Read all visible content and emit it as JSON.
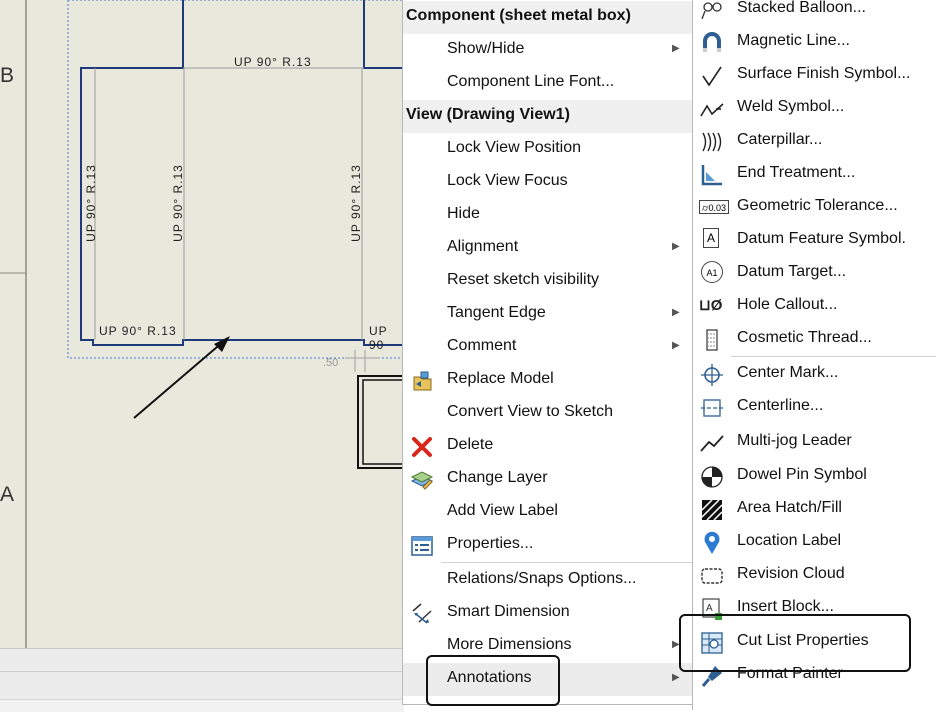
{
  "drawing": {
    "zone_b": "B",
    "zone_a": "A",
    "bend_note_top": "UP 90° R.13",
    "bend_note_v1": "UP 90° R.13",
    "bend_note_v2": "UP 90° R.13",
    "bend_note_v3": "UP 90° R.13",
    "bend_note_bottom_left": "UP 90° R.13",
    "bend_note_bottom_right": "UP 90",
    "dimension_value": ".50"
  },
  "context_menu": {
    "component_header": "Component (sheet metal box)",
    "show_hide": "Show/Hide",
    "component_line_font": "Component Line Font...",
    "view_header": "View (Drawing View1)",
    "lock_view_position": "Lock View Position",
    "lock_view_focus": "Lock View Focus",
    "hide": "Hide",
    "alignment": "Alignment",
    "reset_sketch_visibility": "Reset sketch visibility",
    "tangent_edge": "Tangent Edge",
    "comment": "Comment",
    "replace_model": "Replace Model",
    "convert_view_to_sketch": "Convert View to Sketch",
    "delete": "Delete",
    "change_layer": "Change Layer",
    "add_view_label": "Add View Label",
    "properties": "Properties...",
    "relations_snaps_options": "Relations/Snaps Options...",
    "smart_dimension": "Smart Dimension",
    "more_dimensions": "More Dimensions",
    "annotations": "Annotations"
  },
  "annotations_submenu": {
    "stacked_balloon": "Stacked Balloon...",
    "magnetic_line": "Magnetic Line...",
    "surface_finish_symbol": "Surface Finish Symbol...",
    "weld_symbol": "Weld Symbol...",
    "caterpillar": "Caterpillar...",
    "end_treatment": "End Treatment...",
    "geometric_tolerance": "Geometric Tolerance...",
    "datum_feature_symbol": "Datum Feature Symbol.",
    "datum_target": "Datum Target...",
    "hole_callout": "Hole Callout...",
    "cosmetic_thread": "Cosmetic Thread...",
    "center_mark": "Center Mark...",
    "centerline": "Centerline...",
    "multi_jog_leader": "Multi-jog Leader",
    "dowel_pin_symbol": "Dowel Pin Symbol",
    "area_hatch_fill": "Area Hatch/Fill",
    "location_label": "Location Label",
    "revision_cloud": "Revision Cloud",
    "insert_block": "Insert Block...",
    "cut_list_properties": "Cut List Properties",
    "format_painter": "Format Painter",
    "gtol_icon_text": "⌭0.03",
    "datum_icon_text": "A",
    "datum_target_icon_text": "A1",
    "hole_callout_icon_text": "⊔Ø"
  },
  "colors": {
    "drawing_background": "#e9e8dd",
    "sheet_line": "#1f3a7a",
    "menu_background": "#ffffff",
    "header_background": "#f0f0f0",
    "delete_red": "#d9261c"
  }
}
